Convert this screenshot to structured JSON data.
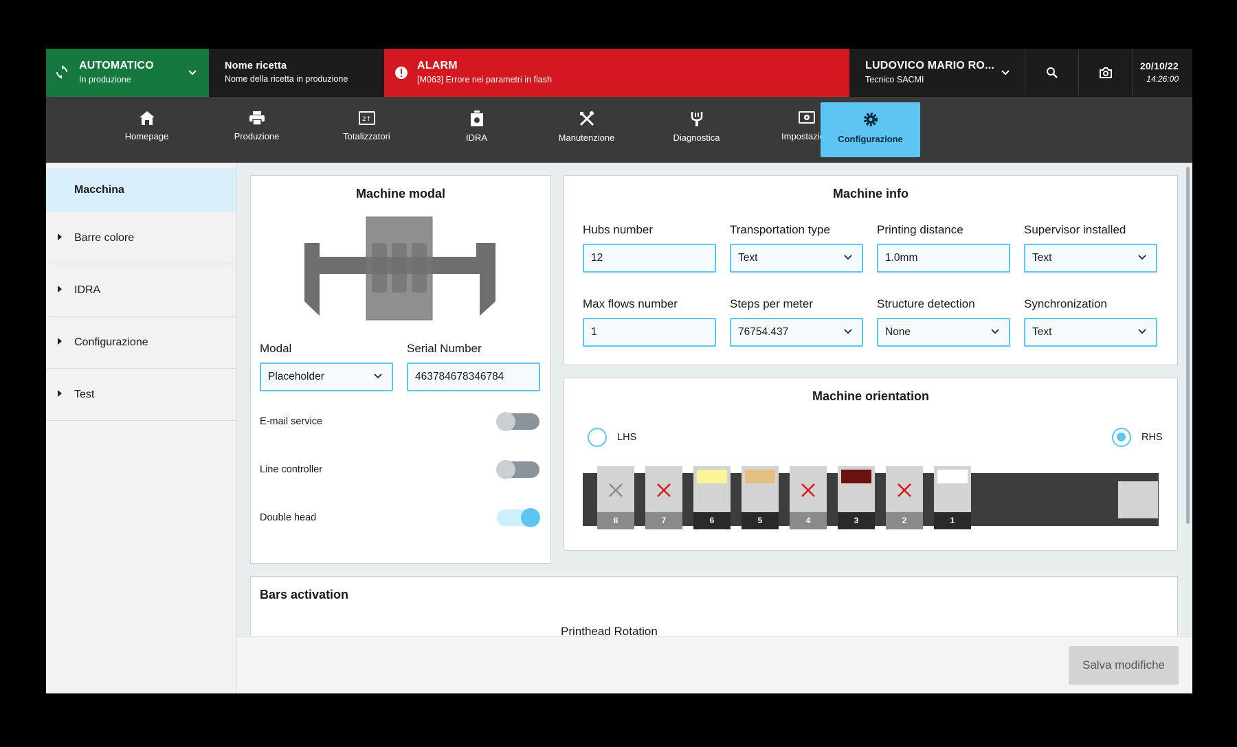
{
  "topbar": {
    "mode": {
      "title": "AUTOMATICO",
      "subtitle": "In produzione"
    },
    "recipe": {
      "title": "Nome ricetta",
      "subtitle": "Nome della ricetta in produzione"
    },
    "alarm": {
      "title": "ALARM",
      "message": "[M063] Errore nei parametri in flash"
    },
    "user": {
      "name": "LUDOVICO MARIO RO...",
      "role": "Tecnico SACMI"
    },
    "date": "20/10/22",
    "time": "14:26:00"
  },
  "nav": {
    "items": [
      {
        "label": "Homepage",
        "icon": "home-icon"
      },
      {
        "label": "Produzione",
        "icon": "printer-icon"
      },
      {
        "label": "Totalizzatori",
        "icon": "counter-icon"
      },
      {
        "label": "IDRA",
        "icon": "idra-icon"
      },
      {
        "label": "Manutenzione",
        "icon": "tools-icon"
      },
      {
        "label": "Diagnostica",
        "icon": "plug-icon"
      },
      {
        "label": "Impostazioni",
        "icon": "settings-screen-icon"
      },
      {
        "label": "Configurazione",
        "icon": "gear-icon"
      }
    ],
    "active": "Configurazione"
  },
  "sidebar": {
    "items": [
      {
        "label": "Macchina"
      },
      {
        "label": "Barre colore"
      },
      {
        "label": "IDRA"
      },
      {
        "label": "Configurazione"
      },
      {
        "label": "Test"
      }
    ]
  },
  "machine_modal": {
    "title": "Machine modal",
    "modal_label": "Modal",
    "modal_value": "Placeholder",
    "serial_label": "Serial Number",
    "serial_value": "463784678346784",
    "toggles": [
      {
        "label": "E-mail service",
        "on": false
      },
      {
        "label": "Line controller",
        "on": false
      },
      {
        "label": "Double head",
        "on": true
      }
    ]
  },
  "machine_info": {
    "title": "Machine info",
    "fields": [
      {
        "label": "Hubs number",
        "value": "12",
        "type": "input"
      },
      {
        "label": "Transportation type",
        "value": "Text",
        "type": "select"
      },
      {
        "label": "Printing distance",
        "value": "1.0mm",
        "type": "input"
      },
      {
        "label": "Supervisor installed",
        "value": "Text",
        "type": "select"
      },
      {
        "label": "Max flows number",
        "value": "1",
        "type": "input"
      },
      {
        "label": "Steps per meter",
        "value": "76754.437",
        "type": "select"
      },
      {
        "label": "Structure detection",
        "value": "None",
        "type": "select"
      },
      {
        "label": "Synchronization",
        "value": "Text",
        "type": "select"
      }
    ]
  },
  "machine_orientation": {
    "title": "Machine orientation",
    "lhs_label": "LHS",
    "rhs_label": "RHS",
    "selected": "RHS",
    "heads": [
      {
        "num": "8",
        "state": "disabled",
        "color": null
      },
      {
        "num": "7",
        "state": "error",
        "color": null
      },
      {
        "num": "6",
        "state": "ok",
        "color": "#fbf59a"
      },
      {
        "num": "5",
        "state": "ok",
        "color": "#e3c07e"
      },
      {
        "num": "4",
        "state": "error",
        "color": null
      },
      {
        "num": "3",
        "state": "ok",
        "color": "#6d1010"
      },
      {
        "num": "2",
        "state": "error",
        "color": null
      },
      {
        "num": "1",
        "state": "ok",
        "color": "#ffffff"
      }
    ]
  },
  "bars_activation": {
    "title": "Bars activation",
    "subtitle": "Printhead Rotation"
  },
  "footer": {
    "save_label": "Salva modifiche"
  },
  "colors": {
    "accent": "#5ec4f2",
    "mode_green": "#15793f",
    "alarm_red": "#d4181f",
    "error_red": "#d4181f"
  }
}
